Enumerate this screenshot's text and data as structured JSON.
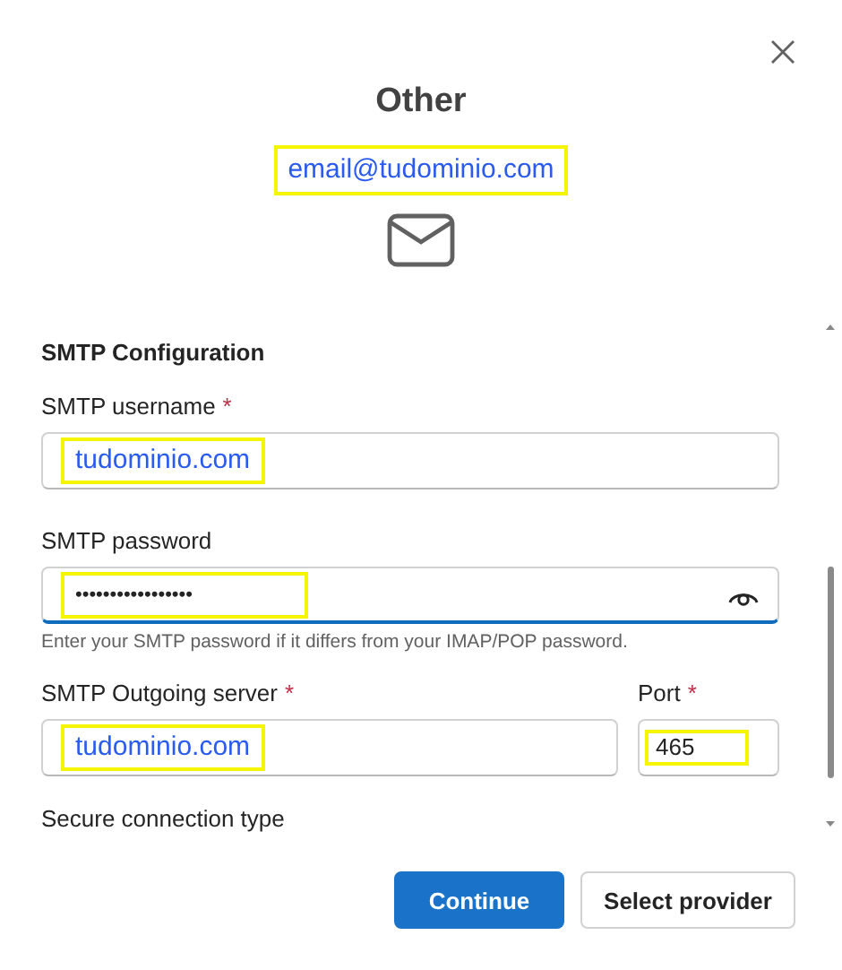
{
  "dialog": {
    "title": "Other",
    "account": {
      "text": "email@tudominio.com",
      "highlighted": true
    }
  },
  "section": {
    "heading": "SMTP Configuration"
  },
  "fields": [
    {
      "kind": "text",
      "label": "SMTP username",
      "required_mark": "*",
      "value": "tudominio.com",
      "highlighted": true,
      "focused": false
    },
    {
      "kind": "password",
      "label": "SMTP password",
      "value": "•••••••••••••••••",
      "highlighted": true,
      "focused": true,
      "hint": "Enter your SMTP password if it differs from your IMAP/POP password."
    }
  ],
  "server": {
    "label": "SMTP Outgoing server",
    "required_mark": "*",
    "value": "tudominio.com",
    "highlighted": true
  },
  "port": {
    "label": "Port",
    "required_mark": "*",
    "value": "465",
    "highlighted": true
  },
  "secure_label": "Secure connection type",
  "buttons": [
    {
      "kind": "primary",
      "label": "Continue"
    },
    {
      "kind": "secondary",
      "label": "Select provider"
    }
  ]
}
